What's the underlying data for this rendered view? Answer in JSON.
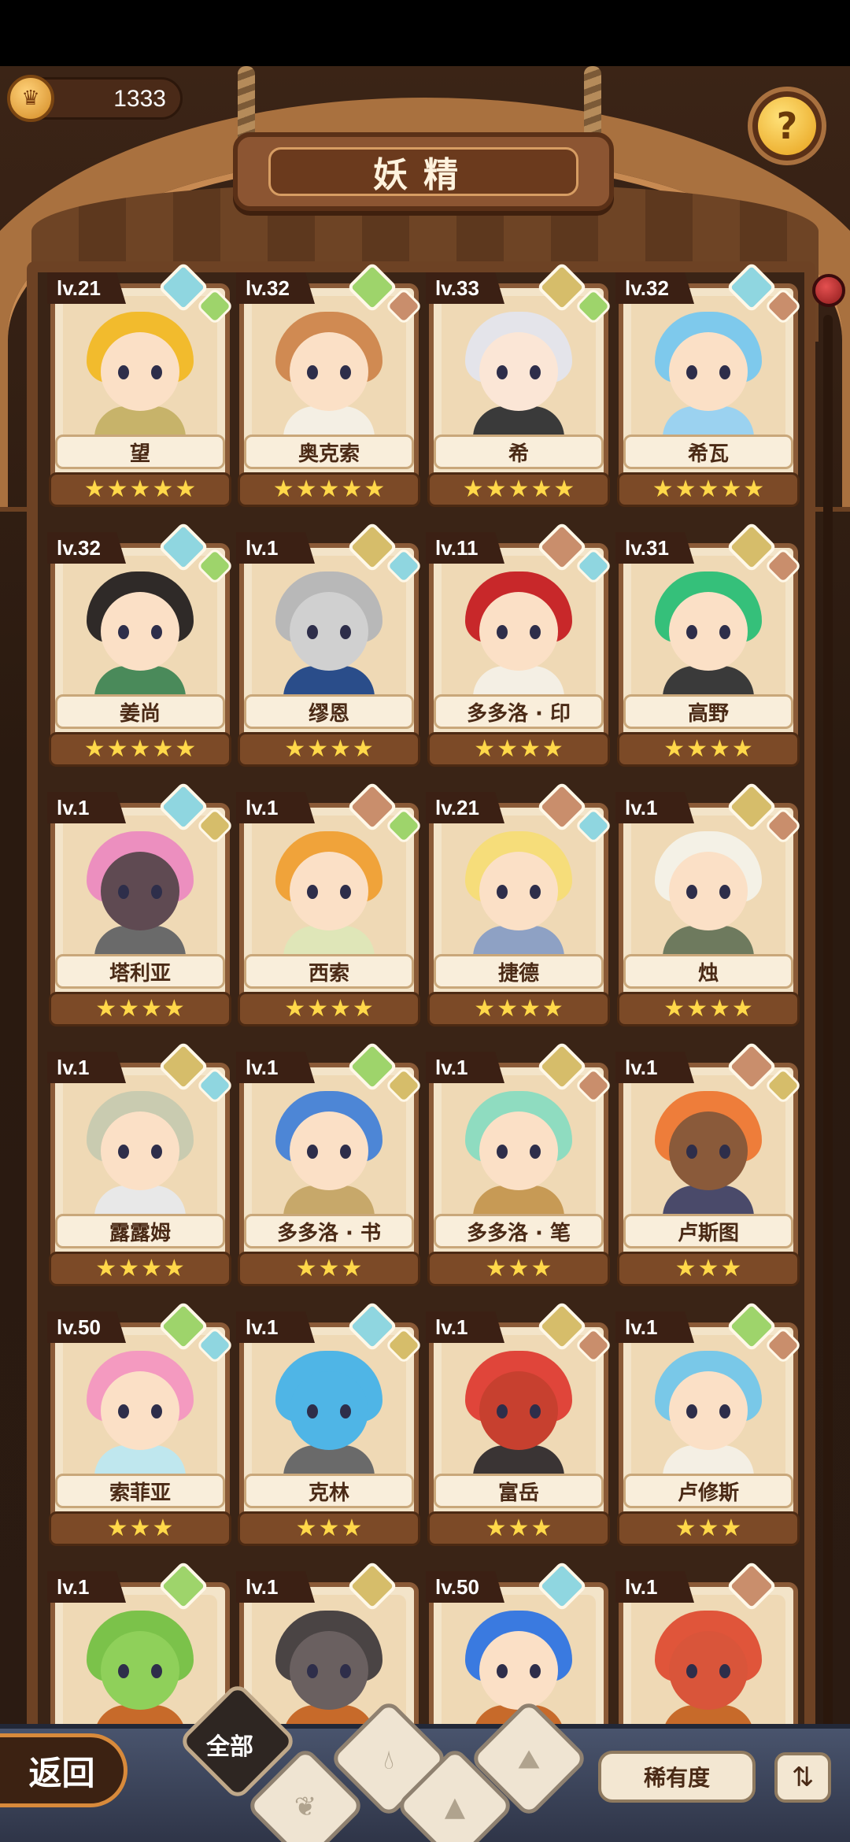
{
  "header": {
    "title": "妖精",
    "currency_value": "1333",
    "currency_icon": "crown-coin-icon",
    "help_icon": "question-sprout-icon"
  },
  "colors": {
    "water": "#8fd6e0",
    "leaf": "#9ed46b",
    "earth": "#d6bd6a",
    "fire": "#c98e6c",
    "star": "#ffd84a"
  },
  "fairies": [
    {
      "level": "lv.21",
      "name": "望",
      "stars": 5,
      "el1": "water",
      "el2": "leaf",
      "hair": "#f2bb2d",
      "skin": "#fbe0c6",
      "body": "#c7b36a"
    },
    {
      "level": "lv.32",
      "name": "奥克索",
      "stars": 5,
      "el1": "leaf",
      "el2": "fire",
      "hair": "#d08a52",
      "skin": "#fbe0c6",
      "body": "#f4efe4"
    },
    {
      "level": "lv.33",
      "name": "希",
      "stars": 5,
      "el1": "earth",
      "el2": "leaf",
      "hair": "#e4e4ea",
      "skin": "#fbe6d6",
      "body": "#3a3a3a"
    },
    {
      "level": "lv.32",
      "name": "希瓦",
      "stars": 5,
      "el1": "water",
      "el2": "fire",
      "hair": "#7ec9ec",
      "skin": "#fbe0c6",
      "body": "#9bd2f0"
    },
    {
      "level": "lv.32",
      "name": "姜尚",
      "stars": 5,
      "el1": "water",
      "el2": "leaf",
      "hair": "#2f2a28",
      "skin": "#fbe0c6",
      "body": "#4a8a5a"
    },
    {
      "level": "lv.1",
      "name": "缪恩",
      "stars": 4,
      "el1": "earth",
      "el2": "water",
      "hair": "#b8b8b8",
      "skin": "#d0d0d0",
      "body": "#2a4d8a"
    },
    {
      "level": "lv.11",
      "name": "多多洛 · 印",
      "stars": 4,
      "el1": "fire",
      "el2": "water",
      "hair": "#c8282a",
      "skin": "#fbe0c6",
      "body": "#f4efe4"
    },
    {
      "level": "lv.31",
      "name": "高野",
      "stars": 4,
      "el1": "earth",
      "el2": "fire",
      "hair": "#35c07a",
      "skin": "#fbe0c6",
      "body": "#3a3a3a"
    },
    {
      "level": "lv.1",
      "name": "塔利亚",
      "stars": 4,
      "el1": "water",
      "el2": "earth",
      "hair": "#ec8fbf",
      "skin": "#5f4a52",
      "body": "#6a6a6a"
    },
    {
      "level": "lv.1",
      "name": "西索",
      "stars": 4,
      "el1": "fire",
      "el2": "leaf",
      "hair": "#f0a33a",
      "skin": "#fbe0c6",
      "body": "#dfe6b8"
    },
    {
      "level": "lv.21",
      "name": "捷德",
      "stars": 4,
      "el1": "fire",
      "el2": "water",
      "hair": "#f6dd7a",
      "skin": "#fbe0c6",
      "body": "#8ea1c4"
    },
    {
      "level": "lv.1",
      "name": "烛",
      "stars": 4,
      "el1": "earth",
      "el2": "fire",
      "hair": "#f4f1e6",
      "skin": "#fbe0c6",
      "body": "#6e7a5e"
    },
    {
      "level": "lv.1",
      "name": "露露姆",
      "stars": 4,
      "el1": "earth",
      "el2": "water",
      "hair": "#c9cbb0",
      "skin": "#fbe0c6",
      "body": "#e8e8e8"
    },
    {
      "level": "lv.1",
      "name": "多多洛 · 书",
      "stars": 3,
      "el1": "leaf",
      "el2": "earth",
      "hair": "#4d86d6",
      "skin": "#fbe0c6",
      "body": "#c7a86a"
    },
    {
      "level": "lv.1",
      "name": "多多洛 · 笔",
      "stars": 3,
      "el1": "earth",
      "el2": "fire",
      "hair": "#8fdcc0",
      "skin": "#fbe0c6",
      "body": "#c79a55"
    },
    {
      "level": "lv.1",
      "name": "卢斯图",
      "stars": 3,
      "el1": "fire",
      "el2": "earth",
      "hair": "#ee7d3a",
      "skin": "#8a5a3a",
      "body": "#4a4a6a"
    },
    {
      "level": "lv.50",
      "name": "索菲亚",
      "stars": 3,
      "el1": "leaf",
      "el2": "water",
      "hair": "#f49ac0",
      "skin": "#fbe0c6",
      "body": "#bfe7ee"
    },
    {
      "level": "lv.1",
      "name": "克林",
      "stars": 3,
      "el1": "water",
      "el2": "earth",
      "hair": "#4fb5e6",
      "skin": "#4fb5e6",
      "body": "#6a6a6a"
    },
    {
      "level": "lv.1",
      "name": "富岳",
      "stars": 3,
      "el1": "earth",
      "el2": "fire",
      "hair": "#e0453a",
      "skin": "#c7402f",
      "body": "#3a3434"
    },
    {
      "level": "lv.1",
      "name": "卢修斯",
      "stars": 3,
      "el1": "leaf",
      "el2": "fire",
      "hair": "#79c8e8",
      "skin": "#fbe0c6",
      "body": "#f4efe4"
    },
    {
      "level": "lv.1",
      "name": "",
      "stars": 0,
      "el1": "leaf",
      "el2": "",
      "hair": "#7bc24a",
      "skin": "#8fd05a",
      "body": "#c76a2a"
    },
    {
      "level": "lv.1",
      "name": "",
      "stars": 0,
      "el1": "earth",
      "el2": "",
      "hair": "#4a4444",
      "skin": "#6a6060",
      "body": "#c76a2a"
    },
    {
      "level": "lv.50",
      "name": "",
      "stars": 0,
      "el1": "water",
      "el2": "",
      "hair": "#3a7ae0",
      "skin": "#fbe0c6",
      "body": "#c76a2a"
    },
    {
      "level": "lv.1",
      "name": "",
      "stars": 0,
      "el1": "fire",
      "el2": "",
      "hair": "#e0553a",
      "skin": "#d9553a",
      "body": "#c76a2a"
    }
  ],
  "bottom": {
    "back_label": "返回",
    "filter_all_label": "全部",
    "filter_icons": [
      "sprout-icon",
      "water-drop-icon",
      "mountain-icon",
      "fire-mountain-icon"
    ],
    "rarity_label": "稀有度",
    "sort_icon": "sort-icon"
  }
}
